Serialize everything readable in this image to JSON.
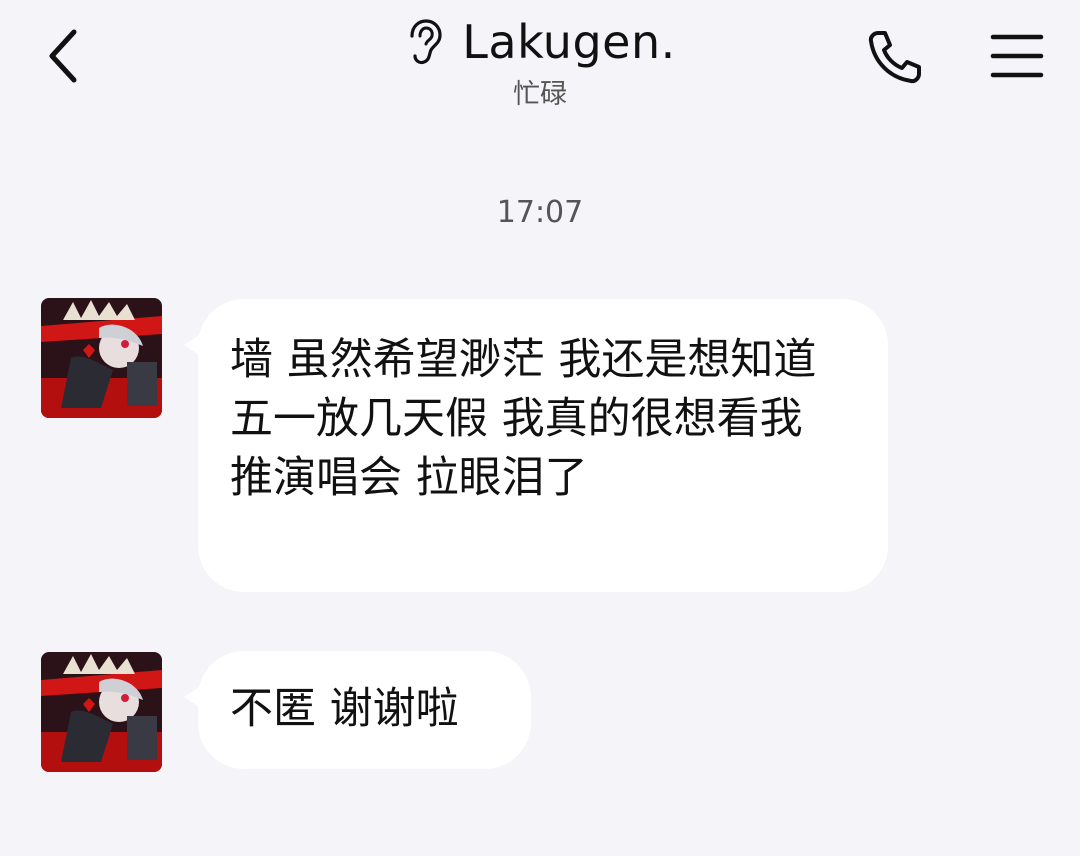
{
  "header": {
    "contact_name": "Lakugen.",
    "status": "忙碌",
    "icons": {
      "back": "chevron-left-icon",
      "listen_mode": "ear-icon",
      "call": "phone-icon",
      "menu": "menu-icon"
    }
  },
  "chat": {
    "timestamp": "17:07",
    "messages": [
      {
        "sender": "contact",
        "text": "墙 虽然希望渺茫 我还是想知道五一放几天假 我真的很想看我推演唱会 拉眼泪了"
      },
      {
        "sender": "contact",
        "text": "不匿 谢谢啦"
      }
    ]
  },
  "colors": {
    "background": "#f4f4f9",
    "bubble": "#ffffff",
    "text": "#111111",
    "muted": "#555555"
  }
}
